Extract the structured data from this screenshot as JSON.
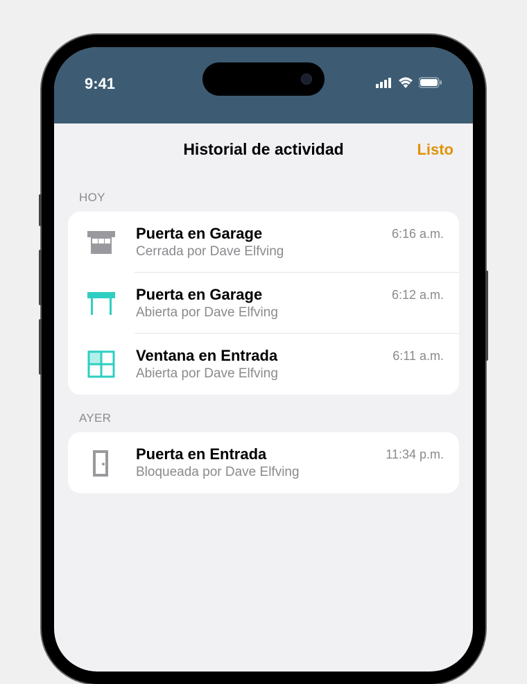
{
  "status": {
    "time": "9:41"
  },
  "nav": {
    "title": "Historial de actividad",
    "done": "Listo"
  },
  "sections": [
    {
      "header": "HOY",
      "items": [
        {
          "icon": "garage-closed",
          "title": "Puerta en Garage",
          "subtitle": "Cerrada por Dave Elfving",
          "time": "6:16 a.m."
        },
        {
          "icon": "garage-open",
          "title": "Puerta en Garage",
          "subtitle": "Abierta por Dave Elfving",
          "time": "6:12 a.m."
        },
        {
          "icon": "window-open",
          "title": "Ventana en Entrada",
          "subtitle": "Abierta por Dave Elfving",
          "time": "6:11 a.m."
        }
      ]
    },
    {
      "header": "AYER",
      "items": [
        {
          "icon": "door-locked",
          "title": "Puerta en Entrada",
          "subtitle": "Bloqueada por Dave Elfving",
          "time": "11:34 p.m."
        }
      ]
    }
  ]
}
